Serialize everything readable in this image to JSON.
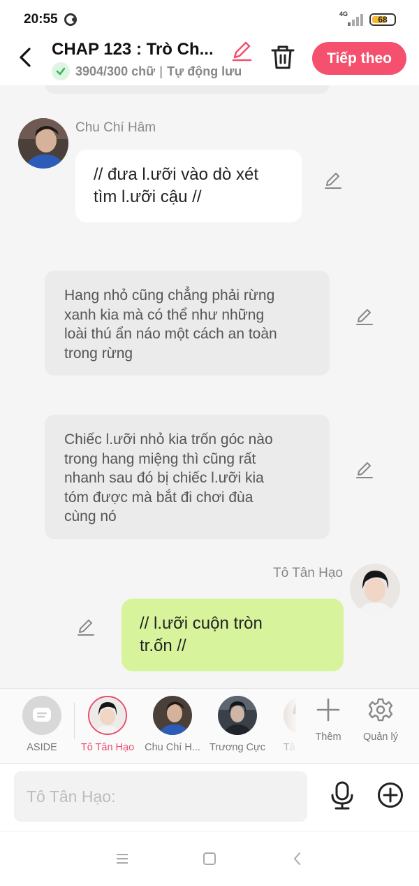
{
  "status_bar": {
    "time": "20:55",
    "network": "4G",
    "battery": "68",
    "battery_level": 0.68
  },
  "header": {
    "title": "CHAP 123 : Trò Ch...",
    "word_count": "3904/300 chữ",
    "separator": "|",
    "autosave": "Tự động lưu",
    "next_label": "Tiếp theo",
    "accent": "#f5506e"
  },
  "messages": {
    "m1": {
      "sender": "Chu Chí Hâm",
      "lines": [
        "// đưa l.ưỡi vào dò xét",
        "tìm l.ưỡi cậu //"
      ]
    },
    "n1": {
      "lines": [
        "Hang nhỏ cũng chẳng phải rừng",
        "xanh kia mà có thể như những",
        "loài thú ẩn náo một cách an toàn",
        "trong rừng"
      ]
    },
    "n2": {
      "lines": [
        "Chiếc l.ưỡi nhỏ kia trốn góc nào",
        "trong hang miệng thì cũng rất",
        "nhanh sau đó bị chiếc l.ưỡi kia",
        "tóm được mà bắt đi chơi đùa",
        "cùng nó"
      ]
    },
    "m2": {
      "sender": "Tô Tân Hạo",
      "lines": [
        "// l.ưỡi cuộn tròn",
        "tr.ốn //"
      ]
    }
  },
  "characters": {
    "aside": "ASIDE",
    "c1": "Tô Tân Hạo",
    "c2": "Chu Chí H...",
    "c3": "Trương Cực",
    "c4": "Tả"
  },
  "tools": {
    "add": "Thêm",
    "manage": "Quản lý"
  },
  "input": {
    "placeholder": "Tô Tân Hạo:"
  },
  "colors": {
    "bubble_green": "#d7f49d",
    "active_char": "#e94d6b",
    "narration_bg": "#ebebeb"
  }
}
